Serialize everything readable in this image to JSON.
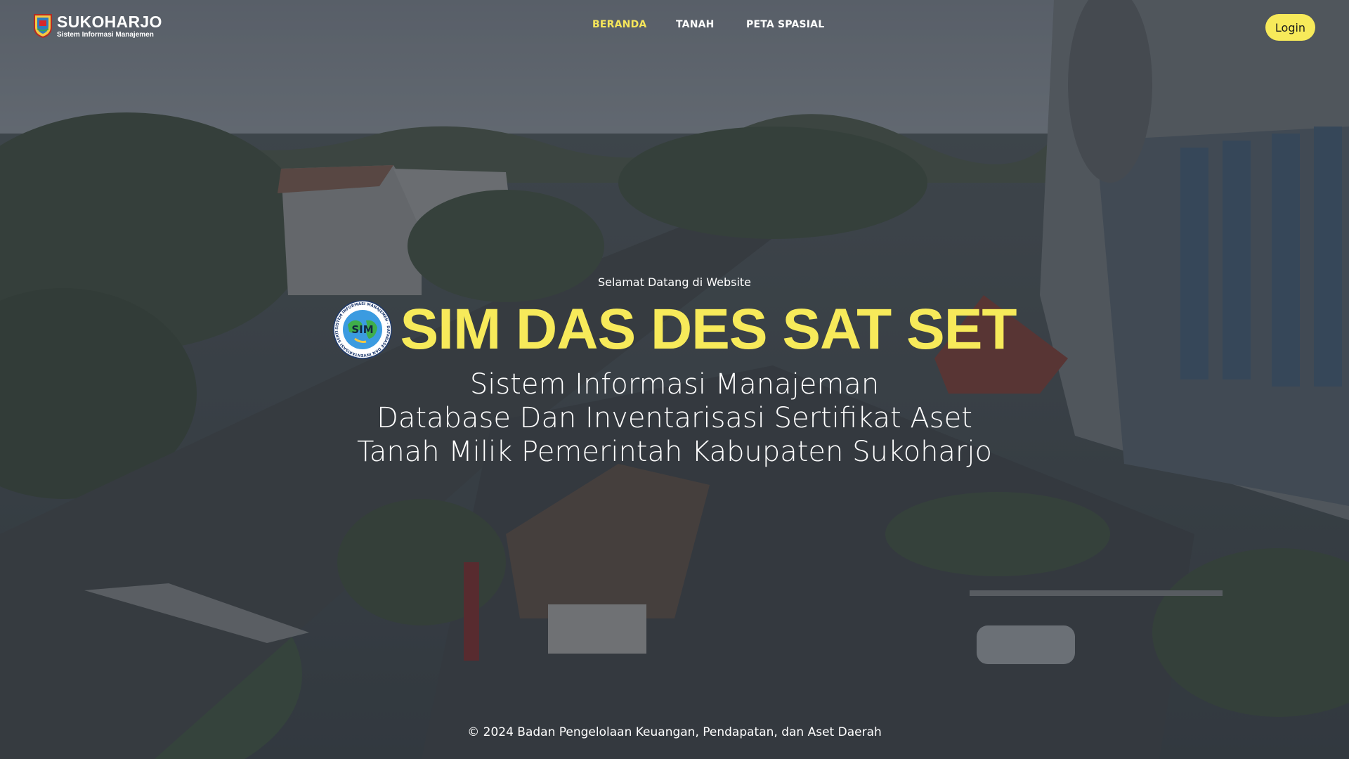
{
  "header": {
    "brand_name": "SUKOHARJO",
    "brand_sub": "Sistem Informasi Manajemen",
    "nav": [
      {
        "label": "BERANDA",
        "active": true
      },
      {
        "label": "TANAH",
        "active": false
      },
      {
        "label": "PETA SPASIAL",
        "active": false
      }
    ],
    "login_label": "Login"
  },
  "hero": {
    "welcome": "Selamat Datang di Website",
    "logo_text": "SIM",
    "logo_ring_text": "SISTEM INFORMASI MANAJEMEN · DATABASE DAN INVENTARISASI SERTIFIKAT ASET ·",
    "title": "SIM DAS DES SAT SET",
    "subtitle_lines": [
      "Sistem Informasi Manajeman",
      "Database Dan Inventarisasi Sertifikat Aset",
      "Tanah Milik Pemerintah Kabupaten Sukoharjo"
    ]
  },
  "footer": {
    "copyright": "© 2024 Badan Pengelolaan Keuangan, Pendapatan, dan Aset Daerah"
  },
  "colors": {
    "accent": "#f7ea5a",
    "text": "#ffffff",
    "overlay": "#282e38"
  },
  "icons": {
    "brand": "sukoharjo-shield-icon",
    "hero_logo": "sim-globe-logo-icon"
  }
}
